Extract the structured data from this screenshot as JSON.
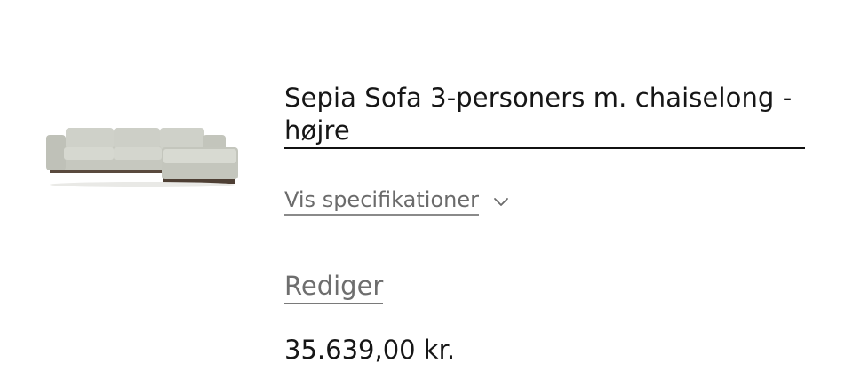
{
  "product": {
    "title": "Sepia Sofa 3-personers m. chaiselong - højre",
    "image_alt": "sofa-thumbnail",
    "specs_label": "Vis specifikationer",
    "specs_icon": "chevron-down-icon",
    "edit_label": "Rediger",
    "price": "35.639,00 kr."
  },
  "colors": {
    "text_primary": "#161616",
    "text_secondary": "#6b6b6b",
    "sofa_fabric": "#c9cbc3",
    "sofa_base": "#5a4a3e"
  }
}
